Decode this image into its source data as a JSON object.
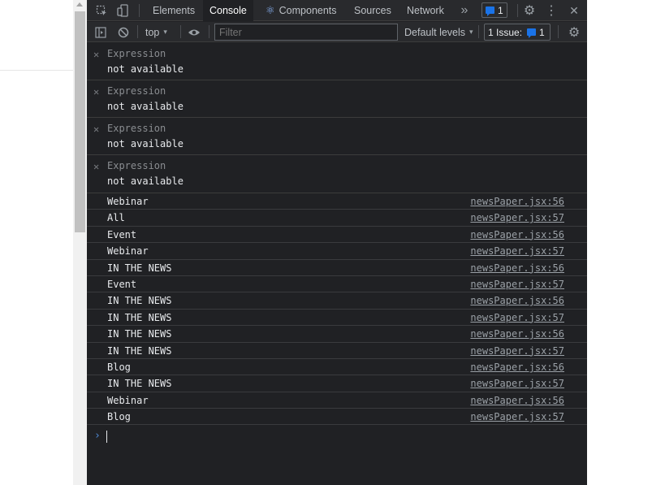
{
  "tabbar": {
    "tabs": [
      {
        "label": "Elements"
      },
      {
        "label": "Console"
      },
      {
        "label": "Components"
      },
      {
        "label": "Sources"
      },
      {
        "label": "Network"
      }
    ],
    "more_tabs": "»",
    "issues_count": "1",
    "settings_icon": "⚙",
    "menu_icon": "⋮",
    "close_icon": "✕"
  },
  "toolbar": {
    "context": "top",
    "filter_placeholder": "Filter",
    "levels_label": "Default levels",
    "issues_label": "1 Issue:",
    "issues_count": "1"
  },
  "expressions": [
    {
      "label": "Expression",
      "value": "not available"
    },
    {
      "label": "Expression",
      "value": "not available"
    },
    {
      "label": "Expression",
      "value": "not available"
    },
    {
      "label": "Expression",
      "value": "not available"
    }
  ],
  "logs": [
    {
      "message": "Webinar",
      "source": "newsPaper.jsx:56"
    },
    {
      "message": "All",
      "source": "newsPaper.jsx:57"
    },
    {
      "message": "Event",
      "source": "newsPaper.jsx:56"
    },
    {
      "message": "Webinar",
      "source": "newsPaper.jsx:57"
    },
    {
      "message": "IN THE NEWS",
      "source": "newsPaper.jsx:56"
    },
    {
      "message": "Event",
      "source": "newsPaper.jsx:57"
    },
    {
      "message": "IN THE NEWS",
      "source": "newsPaper.jsx:56"
    },
    {
      "message": "IN THE NEWS",
      "source": "newsPaper.jsx:57"
    },
    {
      "message": "IN THE NEWS",
      "source": "newsPaper.jsx:56"
    },
    {
      "message": "IN THE NEWS",
      "source": "newsPaper.jsx:57"
    },
    {
      "message": "Blog",
      "source": "newsPaper.jsx:56"
    },
    {
      "message": "IN THE NEWS",
      "source": "newsPaper.jsx:57"
    },
    {
      "message": "Webinar",
      "source": "newsPaper.jsx:56"
    },
    {
      "message": "Blog",
      "source": "newsPaper.jsx:57"
    }
  ],
  "prompt_symbol": "›"
}
